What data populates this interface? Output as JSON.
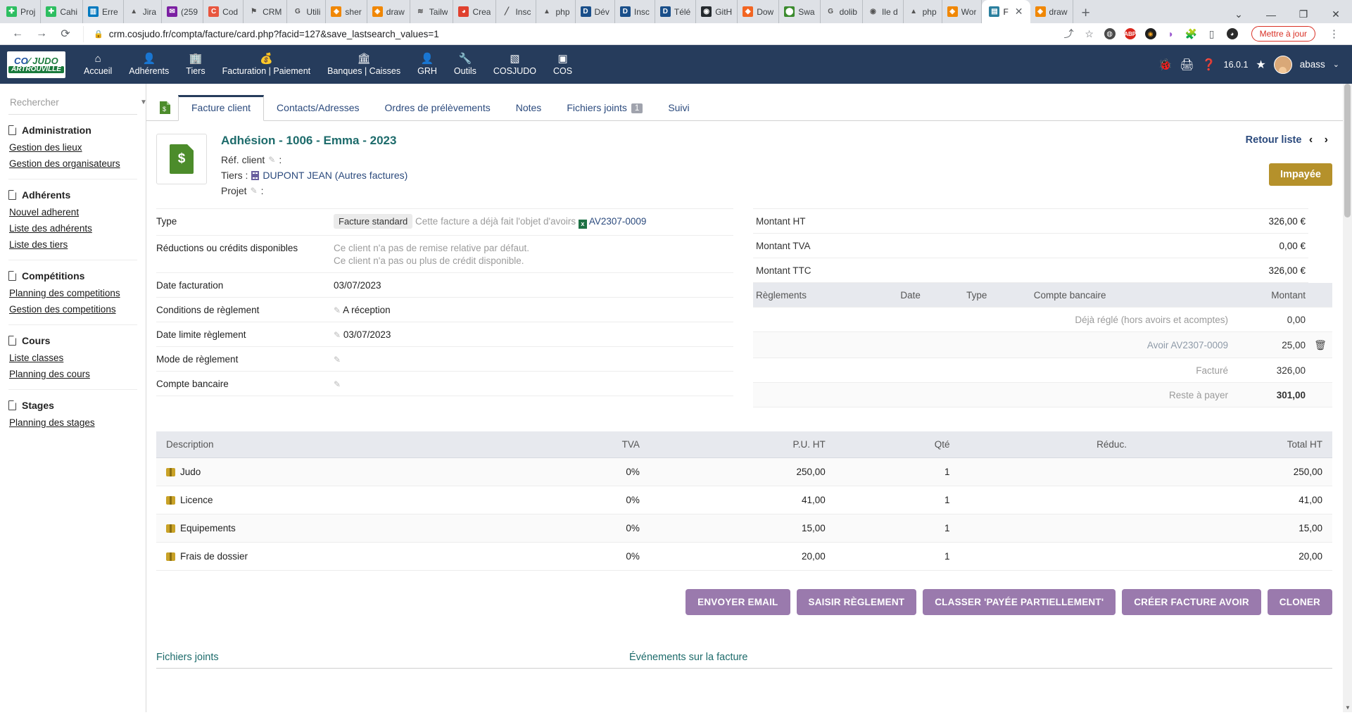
{
  "browser": {
    "tabs": [
      {
        "label": "Proj",
        "icon": "evernote-icon",
        "color": "#2dbe60",
        "glyph": "✚"
      },
      {
        "label": "Cahi",
        "icon": "evernote-icon",
        "color": "#2dbe60",
        "glyph": "✚"
      },
      {
        "label": "Erre",
        "icon": "trello-icon",
        "color": "#0079bf",
        "glyph": "▥"
      },
      {
        "label": "Jira",
        "icon": "jira-icon",
        "color": "#ffffff",
        "glyph": "▲"
      },
      {
        "label": "(259",
        "icon": "mail-icon",
        "color": "#7b1fa2",
        "glyph": "✉"
      },
      {
        "label": "Cod",
        "icon": "codepen-icon",
        "color": "#e8563f",
        "glyph": "C"
      },
      {
        "label": "CRM",
        "icon": "crm-icon",
        "color": "#ffffff",
        "glyph": "⚑"
      },
      {
        "label": "Utili",
        "icon": "google-icon",
        "color": "#ffffff",
        "glyph": "G"
      },
      {
        "label": "sher",
        "icon": "drawio-icon",
        "color": "#f08705",
        "glyph": "◈"
      },
      {
        "label": "draw",
        "icon": "drawio-icon",
        "color": "#f08705",
        "glyph": "◈"
      },
      {
        "label": "Tailw",
        "icon": "tailwind-icon",
        "color": "#ffffff",
        "glyph": "≋"
      },
      {
        "label": "Crea",
        "icon": "creative-icon",
        "color": "#e0412f",
        "glyph": "◕"
      },
      {
        "label": "Insc",
        "icon": "pen-icon",
        "color": "#ffffff",
        "glyph": "╱"
      },
      {
        "label": "php",
        "icon": "phpmyadmin-icon",
        "color": "#ffffff",
        "glyph": "▲"
      },
      {
        "label": "Dév",
        "icon": "docs-icon",
        "color": "#1a4f8a",
        "glyph": "D"
      },
      {
        "label": "Insc",
        "icon": "docs-icon",
        "color": "#1a4f8a",
        "glyph": "D"
      },
      {
        "label": "Télé",
        "icon": "docs-icon",
        "color": "#1a4f8a",
        "glyph": "D"
      },
      {
        "label": "GitH",
        "icon": "github-icon",
        "color": "#24292e",
        "glyph": "◉"
      },
      {
        "label": "Dow",
        "icon": "diamond-icon",
        "color": "#f26522",
        "glyph": "◆"
      },
      {
        "label": "Swa",
        "icon": "swagger-icon",
        "color": "#3b8b2e",
        "glyph": "⬤"
      },
      {
        "label": "dolib",
        "icon": "google-icon",
        "color": "#ffffff",
        "glyph": "G"
      },
      {
        "label": "Ile d",
        "icon": "maps-icon",
        "color": "#ffffff",
        "glyph": "◉"
      },
      {
        "label": "php",
        "icon": "drive-icon",
        "color": "#ffffff",
        "glyph": "▲"
      },
      {
        "label": "Wor",
        "icon": "drawio-icon",
        "color": "#f08705",
        "glyph": "◈"
      }
    ],
    "active_tab": {
      "label": "F",
      "icon": "crm-icon"
    },
    "tab_after": {
      "label": "draw",
      "icon": "drawio-icon",
      "color": "#f08705",
      "glyph": "◈"
    },
    "newtab_label": "+",
    "window_controls": [
      "⌄",
      "—",
      "❐",
      "✕"
    ],
    "url": "crm.cosjudo.fr/compta/facture/card.php?facid=127&save_lastsearch_values=1",
    "lock_icon": "lock-icon",
    "update_label": "Mettre à jour",
    "toolbar_icons": [
      "share-icon",
      "star-icon",
      "ghostery-icon",
      "adblock-icon",
      "honey-icon",
      "extension-purple-icon",
      "puzzle-icon",
      "sidepanel-icon",
      "profile-icon"
    ]
  },
  "topnav": {
    "logo_top": "CO JUDO",
    "logo_bottom": "ARTROUVILLE",
    "items": [
      {
        "label": "Accueil",
        "icon": "home-icon",
        "glyph": "⌂",
        "selected": false
      },
      {
        "label": "Adhérents",
        "icon": "user-icon",
        "glyph": "👤",
        "selected": false
      },
      {
        "label": "Tiers",
        "icon": "building-icon",
        "glyph": "🏢",
        "selected": false
      },
      {
        "label": "Facturation | Paiement",
        "icon": "invoice-icon",
        "glyph": "💰",
        "selected": false
      },
      {
        "label": "Banques | Caisses",
        "icon": "bank-icon",
        "glyph": "🏛",
        "selected": false
      },
      {
        "label": "GRH",
        "icon": "hr-icon",
        "glyph": "👤",
        "selected": false
      },
      {
        "label": "Outils",
        "icon": "tools-icon",
        "glyph": "🔧",
        "selected": false
      },
      {
        "label": "COSJUDO",
        "icon": "module-icon",
        "glyph": "▧",
        "selected": false
      },
      {
        "label": "COS",
        "icon": "module-icon",
        "glyph": "▣",
        "selected": true
      }
    ],
    "right_icons": [
      "bug-icon",
      "print-icon",
      "help-icon"
    ],
    "version": "16.0.1",
    "star_icon": "star-icon",
    "user": "abass",
    "user_caret": "⌄"
  },
  "sidebar": {
    "search_placeholder": "Rechercher",
    "search_value": "",
    "groups": [
      {
        "title": "Administration",
        "items": [
          "Gestion des lieux",
          "Gestion des organisateurs"
        ]
      },
      {
        "title": "Adhérents",
        "items": [
          "Nouvel adherent",
          "Liste des adhérents",
          "Liste des tiers"
        ]
      },
      {
        "title": "Compétitions",
        "items": [
          "Planning des competitions",
          "Gestion des competitions"
        ]
      },
      {
        "title": "Cours",
        "items": [
          "Liste classes",
          "Planning des cours"
        ]
      },
      {
        "title": "Stages",
        "items": [
          "Planning des stages"
        ]
      }
    ]
  },
  "tabs": {
    "doc_icon": "invoice-icon",
    "items": [
      {
        "label": "Facture client",
        "active": true,
        "badge": ""
      },
      {
        "label": "Contacts/Adresses",
        "active": false,
        "badge": ""
      },
      {
        "label": "Ordres de prélèvements",
        "active": false,
        "badge": ""
      },
      {
        "label": "Notes",
        "active": false,
        "badge": ""
      },
      {
        "label": "Fichiers joints",
        "active": false,
        "badge": "1"
      },
      {
        "label": "Suivi",
        "active": false,
        "badge": ""
      }
    ]
  },
  "header": {
    "title": "Adhésion - 1006 - Emma - 2023",
    "ref_label": "Réf. client",
    "ref_value": ":",
    "tiers_label": "Tiers :",
    "tiers_value": "DUPONT JEAN (Autres factures)",
    "projet_label": "Projet",
    "projet_value": ":",
    "back_to_list": "Retour liste",
    "prev_arrow": "‹",
    "next_arrow": "›",
    "status": "Impayée"
  },
  "details": {
    "rows": [
      {
        "key": "Type",
        "type": "type",
        "tag": "Facture standard",
        "note": "Cette facture a déjà fait l'objet d'avoirs",
        "link": "AV2307-0009"
      },
      {
        "key": "Réductions ou crédits disponibles",
        "type": "two-muted",
        "line1": "Ce client n'a pas de remise relative par défaut.",
        "line2": "Ce client n'a pas ou plus de crédit disponible."
      },
      {
        "key": "Date facturation",
        "type": "plain",
        "value": "03/07/2023"
      },
      {
        "key": "Conditions de règlement",
        "type": "edit",
        "value": "A réception"
      },
      {
        "key": "Date limite règlement",
        "type": "edit",
        "value": "03/07/2023"
      },
      {
        "key": "Mode de règlement",
        "type": "edit",
        "value": ""
      },
      {
        "key": "Compte bancaire",
        "type": "edit",
        "value": ""
      }
    ]
  },
  "amounts": {
    "rows": [
      {
        "label": "Montant HT",
        "value": "326,00 €"
      },
      {
        "label": "Montant TVA",
        "value": "0,00 €"
      },
      {
        "label": "Montant TTC",
        "value": "326,00 €"
      }
    ],
    "reglements_header": [
      "Règlements",
      "Date",
      "Type",
      "Compte bancaire",
      "Montant"
    ],
    "reglements": [
      {
        "label": "Déjà réglé (hors avoirs et acomptes)",
        "amount": "0,00",
        "trash": false,
        "alt": false,
        "link": false
      },
      {
        "label": "Avoir AV2307-0009",
        "amount": "25,00",
        "trash": true,
        "alt": true,
        "link": true
      },
      {
        "label": "Facturé",
        "amount": "326,00",
        "trash": false,
        "alt": false,
        "link": false
      },
      {
        "label": "Reste à payer",
        "amount": "301,00",
        "trash": false,
        "alt": true,
        "link": false,
        "big": true
      }
    ]
  },
  "lines": {
    "columns": [
      "Description",
      "TVA",
      "P.U. HT",
      "Qté",
      "Réduc.",
      "Total HT"
    ],
    "rows": [
      {
        "description": "Judo",
        "tva": "0%",
        "pu": "250,00",
        "qty": "1",
        "reduc": "",
        "total": "250,00"
      },
      {
        "description": "Licence",
        "tva": "0%",
        "pu": "41,00",
        "qty": "1",
        "reduc": "",
        "total": "41,00"
      },
      {
        "description": "Equipements",
        "tva": "0%",
        "pu": "15,00",
        "qty": "1",
        "reduc": "",
        "total": "15,00"
      },
      {
        "description": "Frais de dossier",
        "tva": "0%",
        "pu": "20,00",
        "qty": "1",
        "reduc": "",
        "total": "20,00"
      }
    ]
  },
  "actions": [
    {
      "label": "ENVOYER EMAIL"
    },
    {
      "label": "SAISIR RÈGLEMENT"
    },
    {
      "label": "CLASSER 'PAYÉE PARTIELLEMENT'"
    },
    {
      "label": "CRÉER FACTURE AVOIR"
    },
    {
      "label": "CLONER"
    }
  ],
  "footer": {
    "left_title": "Fichiers joints",
    "right_title": "Événements sur la facture"
  },
  "colors": {
    "navy": "#263c5c",
    "accent_teal": "#1d6b6b",
    "status_gold": "#b5912b",
    "button_purple": "#9a7aad",
    "danger_red": "#8b1212"
  }
}
